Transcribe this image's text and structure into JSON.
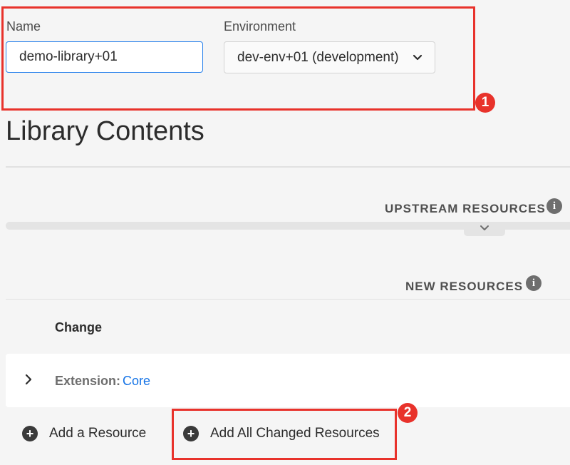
{
  "form": {
    "name_label": "Name",
    "name_value": "demo-library+01",
    "environment_label": "Environment",
    "environment_value": "dev-env+01 (development)"
  },
  "library": {
    "heading": "Library Contents",
    "upstream_title": "UPSTREAM RESOURCES",
    "new_resources_title": "NEW RESOURCES",
    "change_header": "Change",
    "extension_label": "Extension:",
    "extension_link": "Core"
  },
  "actions": {
    "add_resource": "Add a Resource",
    "add_all_changed": "Add All Changed Resources"
  },
  "annotations": {
    "badge_1": "1",
    "badge_2": "2"
  },
  "colors": {
    "annotation": "#e8322b",
    "link": "#1473e6",
    "focus": "#2680eb"
  }
}
